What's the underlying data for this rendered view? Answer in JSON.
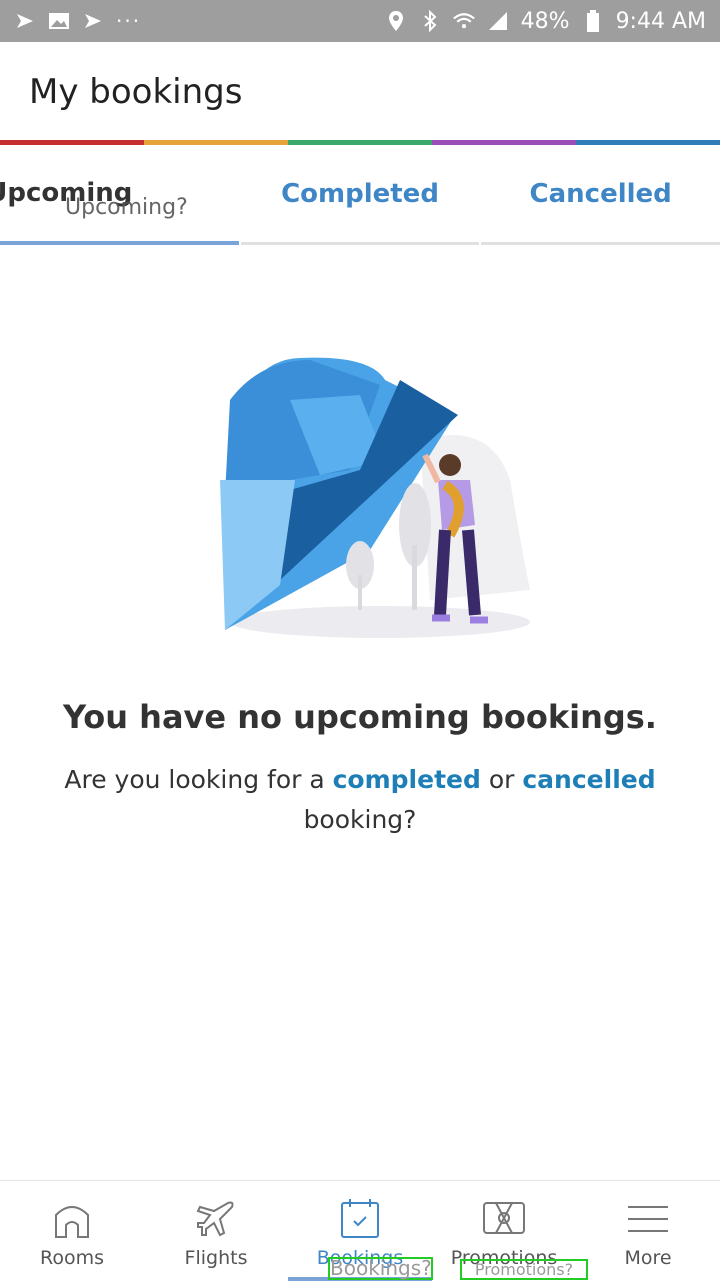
{
  "status_bar": {
    "battery": "48%",
    "time": "9:44 AM",
    "dots": "···"
  },
  "header": {
    "title": "My bookings"
  },
  "stripe_colors": [
    "#c62f2f",
    "#e6a33a",
    "#3aa86a",
    "#9a4fb8",
    "#2e7db8"
  ],
  "tabs": [
    {
      "label": "Upcoming",
      "active": true,
      "ghost": "Upcoming?"
    },
    {
      "label": "Completed",
      "active": false
    },
    {
      "label": "Cancelled",
      "active": false
    }
  ],
  "empty_state": {
    "title": "You have no upcoming bookings.",
    "sub_before": "Are you looking for a ",
    "link_completed": "completed",
    "sub_middle": " or ",
    "link_cancelled": "cancelled",
    "sub_after": "booking?"
  },
  "bottom_nav": {
    "items": [
      {
        "label": "Rooms",
        "icon": "house-icon"
      },
      {
        "label": "Flights",
        "icon": "plane-icon"
      },
      {
        "label": "Bookings",
        "icon": "calendar-check-icon",
        "active": true
      },
      {
        "label": "Promotions",
        "icon": "tag-icon"
      },
      {
        "label": "More",
        "icon": "menu-icon"
      }
    ],
    "ghost_bookings": "Bookings?",
    "ghost_promotions": "Promotions?"
  },
  "colors": {
    "accent": "#3f86c6",
    "link": "#1e7fb8",
    "status_bar": "#9e9e9e"
  }
}
